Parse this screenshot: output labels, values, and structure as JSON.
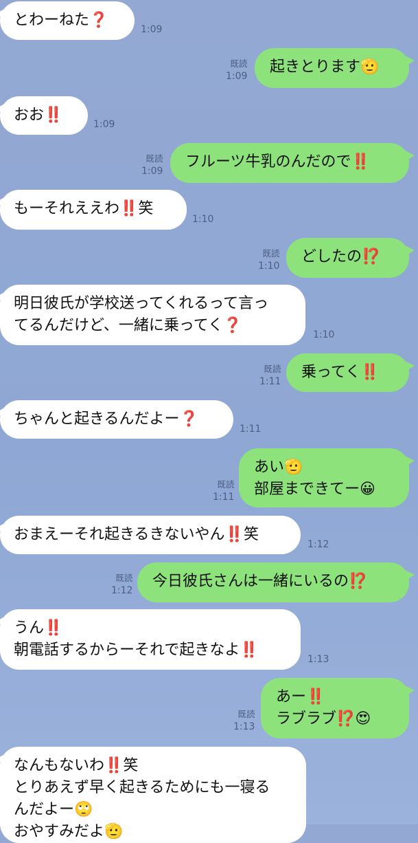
{
  "messages": [
    {
      "side": "in",
      "lines": [
        "とわーねた❓"
      ],
      "time": "1:09"
    },
    {
      "side": "out",
      "lines": [
        "起きとります🫡"
      ],
      "read": "既読",
      "time": "1:09"
    },
    {
      "side": "in",
      "lines": [
        "おお‼️"
      ],
      "time": "1:09"
    },
    {
      "side": "out",
      "lines": [
        "フルーツ牛乳のんだので‼️"
      ],
      "read": "既読",
      "time": "1:09"
    },
    {
      "side": "in",
      "lines": [
        "もーそれええわ‼️笑"
      ],
      "time": "1:10"
    },
    {
      "side": "out",
      "lines": [
        "どしたの⁉️"
      ],
      "read": "既読",
      "time": "1:10"
    },
    {
      "side": "in",
      "lines": [
        "明日彼氏が学校送ってくれるって言っ",
        "てるんだけど、一緒に乗ってく❓"
      ],
      "time": "1:10"
    },
    {
      "side": "out",
      "lines": [
        "乗ってく‼️"
      ],
      "read": "既読",
      "time": "1:11"
    },
    {
      "side": "in",
      "lines": [
        "ちゃんと起きるんだよー❓"
      ],
      "time": "1:11"
    },
    {
      "side": "out",
      "lines": [
        "あい🫡",
        "部屋まできてー😀"
      ],
      "read": "既読",
      "time": "1:11"
    },
    {
      "side": "in",
      "lines": [
        "おまえーそれ起きるきないやん‼️笑"
      ],
      "time": "1:12"
    },
    {
      "side": "out",
      "lines": [
        "今日彼氏さんは一緒にいるの⁉️"
      ],
      "read": "既読",
      "time": "1:12"
    },
    {
      "side": "in",
      "lines": [
        "うん‼️",
        "朝電話するからーそれで起きなよ‼️"
      ],
      "time": "1:13"
    },
    {
      "side": "out",
      "lines": [
        "あー‼️",
        "ラブラブ⁉️😍"
      ],
      "read": "既読",
      "time": "1:13"
    },
    {
      "side": "in",
      "lines": [
        "なんもないわ‼️笑",
        "とりあえず早く起きるためにも一寝る",
        "んだよー🙄",
        "おやすみだよ🫡"
      ],
      "time": ""
    }
  ]
}
